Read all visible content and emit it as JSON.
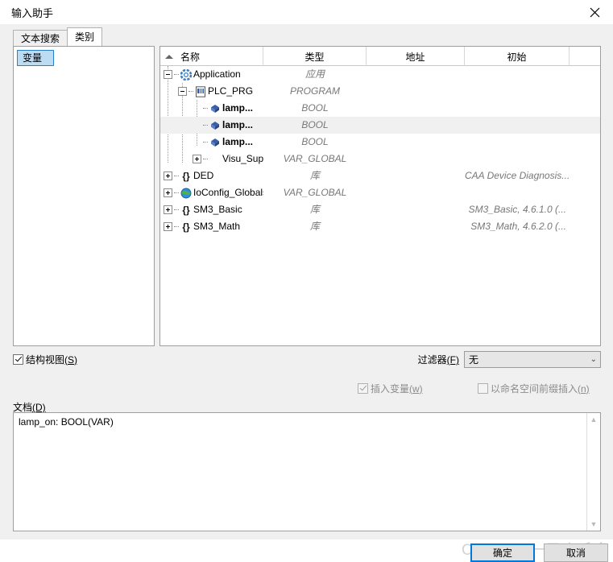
{
  "window": {
    "title": "输入助手",
    "close_icon": "close-icon"
  },
  "tabs": [
    {
      "label": "文本搜索",
      "active": false
    },
    {
      "label": "类别",
      "active": true
    }
  ],
  "categories": {
    "items": [
      {
        "label": "变量",
        "selected": true
      }
    ]
  },
  "tree": {
    "columns": [
      {
        "label": "名称",
        "sort": "asc"
      },
      {
        "label": "类型"
      },
      {
        "label": "地址"
      },
      {
        "label": "初始"
      }
    ],
    "rows": [
      {
        "name": "Application",
        "type": "应用",
        "address": "",
        "initial": "",
        "depth": 0,
        "twisty": "minus",
        "icon": "gear-icon",
        "bold": false,
        "selected": false
      },
      {
        "name": "PLC_PRG",
        "type": "PROGRAM",
        "address": "",
        "initial": "",
        "depth": 1,
        "twisty": "minus",
        "icon": "program-icon",
        "bold": false,
        "selected": false
      },
      {
        "name": "lamp...",
        "type": "BOOL",
        "address": "",
        "initial": "",
        "depth": 2,
        "twisty": "none",
        "icon": "variable-icon",
        "bold": true,
        "selected": false
      },
      {
        "name": "lamp...",
        "type": "BOOL",
        "address": "",
        "initial": "",
        "depth": 2,
        "twisty": "none",
        "icon": "variable-icon",
        "bold": true,
        "selected": true
      },
      {
        "name": "lamp...",
        "type": "BOOL",
        "address": "",
        "initial": "",
        "depth": 2,
        "twisty": "none",
        "icon": "variable-icon",
        "bold": true,
        "selected": false
      },
      {
        "name": "Visu_Super...",
        "type": "VAR_GLOBAL",
        "address": "",
        "initial": "",
        "depth": 2,
        "twisty": "plus",
        "icon": "none",
        "bold": false,
        "selected": false
      },
      {
        "name": "DED",
        "type": "库",
        "address": "",
        "initial": "CAA Device Diagnosis...",
        "depth": 0,
        "twisty": "plus",
        "icon": "braces-icon",
        "bold": false,
        "selected": false
      },
      {
        "name": "IoConfig_Globals",
        "type": "VAR_GLOBAL",
        "address": "",
        "initial": "",
        "depth": 0,
        "twisty": "plus",
        "icon": "globe-icon",
        "bold": false,
        "selected": false
      },
      {
        "name": "SM3_Basic",
        "type": "库",
        "address": "",
        "initial": "SM3_Basic, 4.6.1.0 (...",
        "depth": 0,
        "twisty": "plus",
        "icon": "braces-icon",
        "bold": false,
        "selected": false
      },
      {
        "name": "SM3_Math",
        "type": "库",
        "address": "",
        "initial": "SM3_Math, 4.6.2.0 (...",
        "depth": 0,
        "twisty": "plus",
        "icon": "braces-icon",
        "bold": false,
        "selected": false
      }
    ]
  },
  "options": {
    "structured_view": {
      "label": "结构视图",
      "accel": "(S)",
      "checked": true,
      "enabled": true
    },
    "insert_variable": {
      "label": "插入变量",
      "accel": "(w)",
      "checked": true,
      "enabled": false
    },
    "insert_with_ns": {
      "label": "以命名空间前缀插入",
      "accel": "(n)",
      "checked": false,
      "enabled": false
    },
    "filter": {
      "label": "过滤器",
      "accel": "(F)",
      "value": "无",
      "chevron": "chevron-down-icon"
    }
  },
  "documentation": {
    "label": "文档",
    "accel": "(D)",
    "text": "lamp_on: BOOL(VAR)",
    "scroll_up": "▲",
    "scroll_down": "▼"
  },
  "buttons": {
    "ok": "确定",
    "cancel": "取消"
  },
  "watermark": "CSDN @一只小毛多",
  "colors": {
    "accent": "#0078d7",
    "selection_fill": "#bcdcf4",
    "selection_border": "#2a7fc9",
    "row_selected": "#f0f0f0",
    "dialog_bg": "#f0f0f0",
    "panel_bg": "#ffffff",
    "italic_text": "#777777"
  }
}
